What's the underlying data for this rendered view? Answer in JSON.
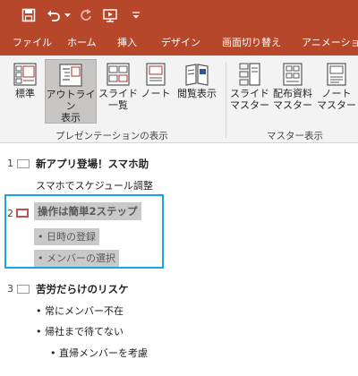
{
  "quick_access": {
    "items": [
      {
        "icon": "save-icon"
      },
      {
        "icon": "undo-icon"
      },
      {
        "icon": "undo-dropdown-icon"
      },
      {
        "icon": "redo-icon"
      },
      {
        "icon": "start-from-beginning-icon"
      },
      {
        "icon": "customize-toolbar-icon"
      }
    ]
  },
  "ribbon_tabs": [
    "ファイル",
    "ホーム",
    "挿入",
    "デザイン",
    "画面切り替え",
    "アニメーション"
  ],
  "ribbon": {
    "presentation_views": {
      "group_label": "プレゼンテーションの表示",
      "buttons": [
        {
          "label": "標準",
          "icon": "normal-view-icon",
          "active": false
        },
        {
          "label": "アウトライン\n表示",
          "icon": "outline-view-icon",
          "active": true
        },
        {
          "label": "スライド\n一覧",
          "icon": "slide-sorter-icon",
          "active": false
        },
        {
          "label": "ノート",
          "icon": "notes-page-icon",
          "active": false
        },
        {
          "label": "閲覧表示",
          "icon": "reading-view-icon",
          "active": false
        }
      ]
    },
    "master_views": {
      "group_label": "マスター表示",
      "buttons": [
        {
          "label": "スライド\nマスター",
          "icon": "slide-master-icon",
          "active": false
        },
        {
          "label": "配布資料\nマスター",
          "icon": "handout-master-icon",
          "active": false
        },
        {
          "label": "ノート\nマスター",
          "icon": "notes-master-icon",
          "active": false
        }
      ]
    }
  },
  "outline": {
    "slides": [
      {
        "number": "1",
        "title": "新アプリ登場！スマホ助",
        "bullets": [
          "スマホでスケジュール調整"
        ]
      },
      {
        "number": "2",
        "title": "操作は簡単2ステップ",
        "bullets": [
          "• 日時の登録",
          "• メンバーの選択"
        ]
      },
      {
        "number": "3",
        "title": "苦労だらけのリスケ",
        "bullets": [
          "• 常にメンバー不在",
          "• 帰社まで待てない",
          "• 直帰メンバーを考慮"
        ]
      }
    ]
  },
  "colors": {
    "accent": "#b7472a",
    "selection_border": "#1aa3e8",
    "selected_thumbnail": "#c0504d",
    "text_highlight": "#c9c9c9"
  }
}
